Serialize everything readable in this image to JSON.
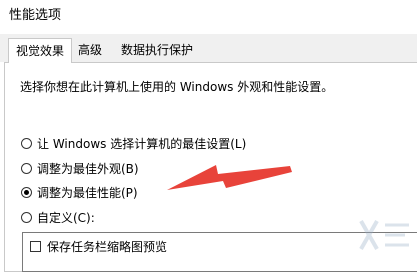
{
  "window": {
    "title": "性能选项"
  },
  "tabs": [
    {
      "label": "视觉效果",
      "active": true
    },
    {
      "label": "高级",
      "active": false
    },
    {
      "label": "数据执行保护",
      "active": false
    }
  ],
  "visual_effects": {
    "intro": "选择你想在此计算机上使用的 Windows 外观和性能设置。",
    "options": [
      {
        "label": "让 Windows 选择计算机的最佳设置(L)",
        "checked": false
      },
      {
        "label": "调整为最佳外观(B)",
        "checked": false
      },
      {
        "label": "调整为最佳性能(P)",
        "checked": true
      },
      {
        "label": "自定义(C):",
        "checked": false
      }
    ],
    "custom_items": [
      {
        "label": "保存任务栏缩略图预览",
        "checked": false
      }
    ]
  },
  "annotation": {
    "arrow_color": "#e8433a"
  }
}
